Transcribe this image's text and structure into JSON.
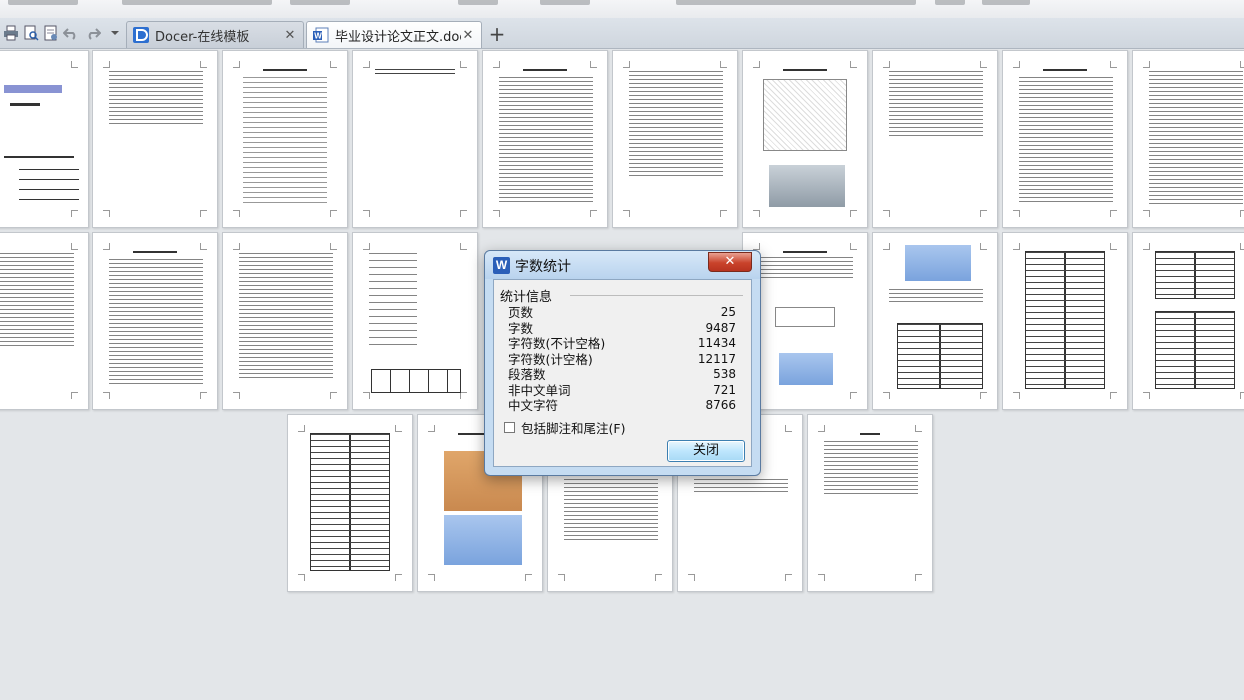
{
  "toolbar": {
    "quick_access": [
      "print-icon",
      "print-preview-icon",
      "document-export-icon",
      "undo-icon",
      "redo-icon",
      "more-icon"
    ]
  },
  "tabs": [
    {
      "label": "Docer-在线模板",
      "icon": "docer-icon",
      "active": false
    },
    {
      "label": "毕业设计论文正文.doc",
      "icon": "word-doc-icon",
      "active": true
    }
  ],
  "dialog": {
    "title": "字数统计",
    "section_label": "统计信息",
    "stats": [
      {
        "label": "页数",
        "value": "25"
      },
      {
        "label": "字数",
        "value": "9487"
      },
      {
        "label": "字符数(不计空格)",
        "value": "11434"
      },
      {
        "label": "字符数(计空格)",
        "value": "12117"
      },
      {
        "label": "段落数",
        "value": "538"
      },
      {
        "label": "非中文单词",
        "value": "721"
      },
      {
        "label": "中文字符",
        "value": "8766"
      }
    ],
    "checkbox_label": "包括脚注和尾注(F)",
    "checkbox_checked": false,
    "close_button": "关闭",
    "close_icon": "close-x-icon"
  },
  "colors": {
    "dialog_frame": "#c5dcf2",
    "close_button_red": "#c9432b",
    "page_background": "#e3e6e9"
  }
}
